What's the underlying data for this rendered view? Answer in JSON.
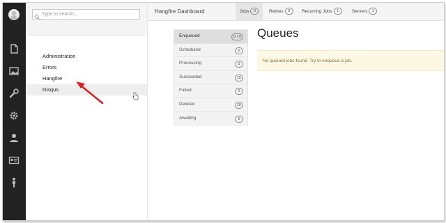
{
  "search": {
    "placeholder": "Type to search..."
  },
  "sidebar": {
    "items": [
      {
        "label": "Administration"
      },
      {
        "label": "Errors"
      },
      {
        "label": "Hangfire"
      },
      {
        "label": "Disqus"
      }
    ]
  },
  "rail_icons": [
    "avatar",
    "document-icon",
    "image-icon",
    "wrench-icon",
    "gear-icon",
    "user-icon",
    "id-card-icon",
    "person-icon"
  ],
  "dashboard": {
    "brand": "Hangfire Dashboard",
    "tabs": [
      {
        "label": "Jobs",
        "count": "0"
      },
      {
        "label": "Retries",
        "count": "0"
      },
      {
        "label": "Recurring Jobs",
        "count": "1"
      },
      {
        "label": "Servers",
        "count": "1"
      }
    ],
    "states": [
      {
        "label": "Enqueued",
        "count": "0 / 0"
      },
      {
        "label": "Scheduled",
        "count": "0"
      },
      {
        "label": "Processing",
        "count": "0"
      },
      {
        "label": "Succeeded",
        "count": "15"
      },
      {
        "label": "Failed",
        "count": "0"
      },
      {
        "label": "Deleted",
        "count": "10"
      },
      {
        "label": "Awaiting",
        "count": "0"
      }
    ],
    "title": "Queues",
    "empty_message": "No queued jobs found. Try to enqueue a job."
  },
  "colors": {
    "rail": "#222222",
    "notice_bg": "#fcf8e3",
    "notice_text": "#8a6d3b",
    "annotation_arrow": "#e02020"
  }
}
